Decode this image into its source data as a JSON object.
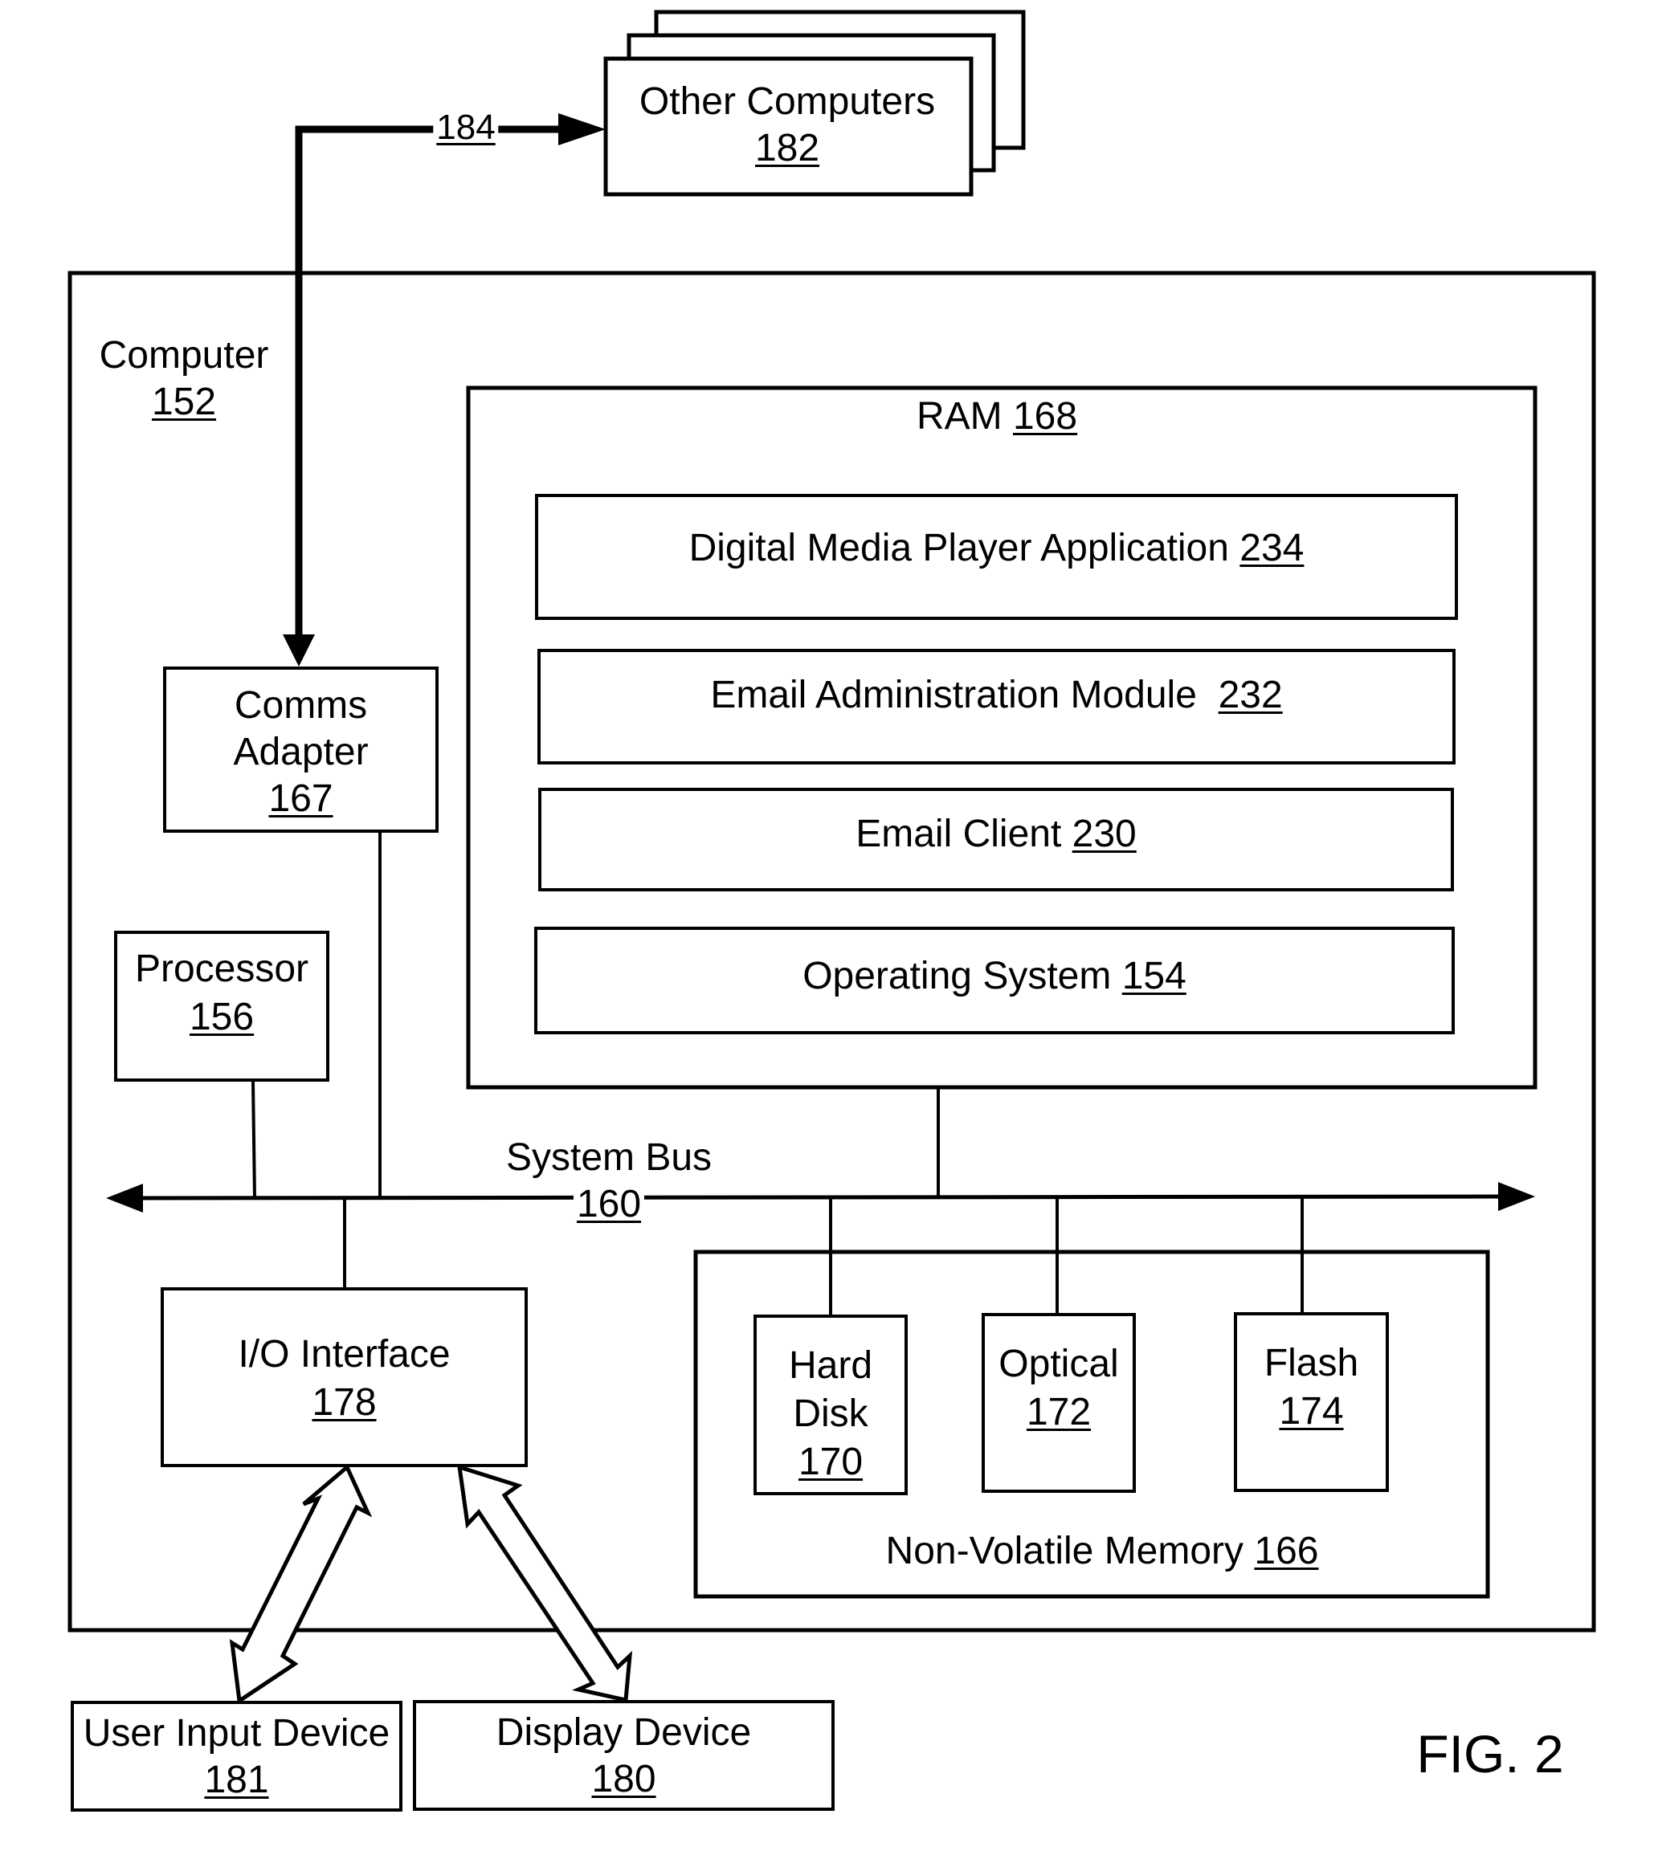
{
  "figure_label": "FIG. 2",
  "other_computers": {
    "label": "Other Computers",
    "ref": "182"
  },
  "network_link": {
    "ref": "184"
  },
  "computer": {
    "label": "Computer",
    "ref": "152"
  },
  "ram": {
    "label": "RAM",
    "ref": "168",
    "modules": [
      {
        "label": "Digital Media Player Application",
        "ref": "234"
      },
      {
        "label": "Email Administration Module",
        "ref": "232"
      },
      {
        "label": "Email Client",
        "ref": "230"
      },
      {
        "label": "Operating System",
        "ref": "154"
      }
    ]
  },
  "comms_adapter": {
    "line1": "Comms",
    "line2": "Adapter",
    "ref": "167"
  },
  "processor": {
    "label": "Processor",
    "ref": "156"
  },
  "system_bus": {
    "label": "System Bus",
    "ref": "160"
  },
  "io_interface": {
    "label": "I/O Interface",
    "ref": "178"
  },
  "non_volatile_memory": {
    "label": "Non-Volatile Memory",
    "ref": "166",
    "devices": [
      {
        "line1": "Hard",
        "line2": "Disk",
        "ref": "170"
      },
      {
        "line1": "Optical",
        "ref": "172"
      },
      {
        "line1": "Flash",
        "ref": "174"
      }
    ]
  },
  "user_input_device": {
    "label": "User Input Device",
    "ref": "181"
  },
  "display_device": {
    "label": "Display Device",
    "ref": "180"
  }
}
